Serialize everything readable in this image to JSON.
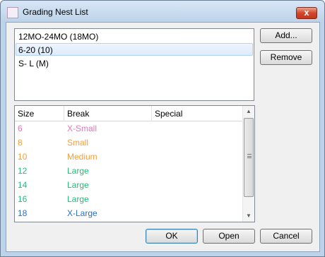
{
  "window": {
    "title": "Grading Nest List",
    "close_glyph": "x",
    "title_icon": "app-icon"
  },
  "nest_list": {
    "items": [
      {
        "label": "12MO-24MO (18MO)",
        "selected": false
      },
      {
        "label": "6-20 (10)",
        "selected": true
      },
      {
        "label": "S- L (M)",
        "selected": false
      }
    ]
  },
  "side_buttons": {
    "add_label": "Add...",
    "remove_label": "Remove"
  },
  "size_grid": {
    "columns": [
      "Size",
      "Break",
      "Special"
    ],
    "rows": [
      {
        "size": "6",
        "break": "X-Small",
        "special": "",
        "color": "#e07ab4"
      },
      {
        "size": "8",
        "break": "Small",
        "special": "",
        "color": "#f0a040"
      },
      {
        "size": "10",
        "break": "Medium",
        "special": "",
        "color": "#f0a040"
      },
      {
        "size": "12",
        "break": "Large",
        "special": "",
        "color": "#2ab87a"
      },
      {
        "size": "14",
        "break": "Large",
        "special": "",
        "color": "#2ab87a"
      },
      {
        "size": "16",
        "break": "Large",
        "special": "",
        "color": "#2ab87a"
      },
      {
        "size": "18",
        "break": "X-Large",
        "special": "",
        "color": "#2a6fc0"
      }
    ],
    "scroll_up_glyph": "▲",
    "scroll_down_glyph": "▼"
  },
  "footer": {
    "ok_label": "OK",
    "open_label": "Open",
    "cancel_label": "Cancel"
  }
}
